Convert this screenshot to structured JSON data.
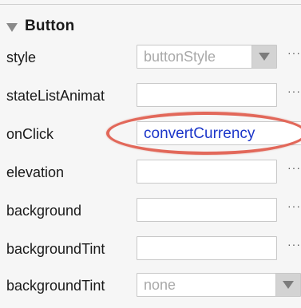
{
  "section": {
    "title": "Button"
  },
  "rows": [
    {
      "label": "style",
      "value": "buttonStyle",
      "kind": "select"
    },
    {
      "label": "stateListAnimat",
      "value": "",
      "kind": "text"
    },
    {
      "label": "onClick",
      "value": "convertCurrency",
      "kind": "select-highlight"
    },
    {
      "label": "elevation",
      "value": "",
      "kind": "text"
    },
    {
      "label": "background",
      "value": "",
      "kind": "text"
    },
    {
      "label": "backgroundTint",
      "value": "",
      "kind": "text"
    },
    {
      "label": "backgroundTint",
      "value": "none",
      "kind": "select"
    }
  ],
  "more_label": "···",
  "colors": {
    "highlight": "#e2685a",
    "link_value": "#1c36c9"
  }
}
